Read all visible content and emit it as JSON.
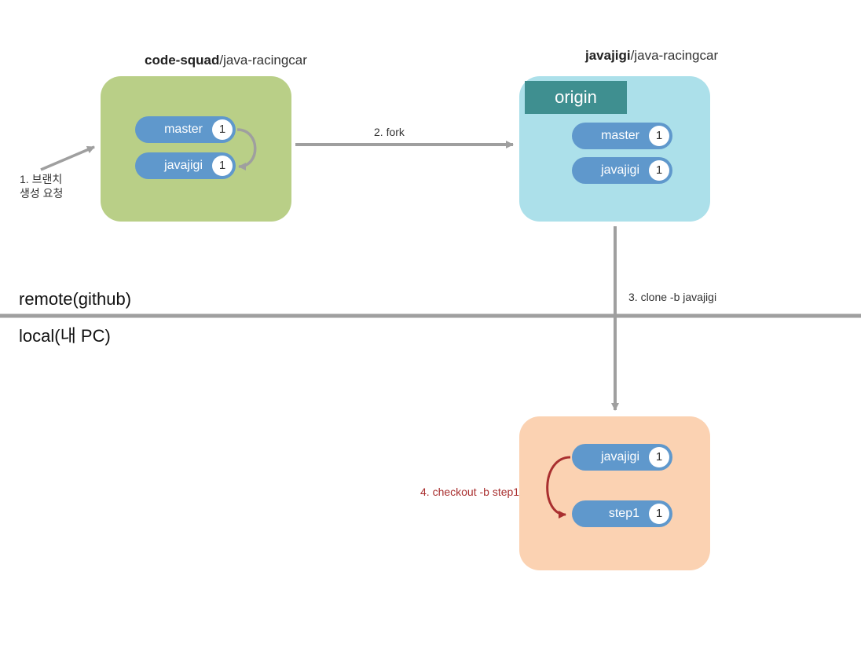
{
  "repo_left": {
    "title_bold": "code-squad",
    "title_rest": "/java-racingcar",
    "branches": [
      {
        "name": "master",
        "count": "1"
      },
      {
        "name": "javajigi",
        "count": "1"
      }
    ]
  },
  "repo_right": {
    "title_bold": "javajigi",
    "title_rest": "/java-racingcar",
    "origin_label": "origin",
    "branches": [
      {
        "name": "master",
        "count": "1"
      },
      {
        "name": "javajigi",
        "count": "1"
      }
    ]
  },
  "repo_local": {
    "branches": [
      {
        "name": "javajigi",
        "count": "1"
      },
      {
        "name": "step1",
        "count": "1"
      }
    ]
  },
  "actions": {
    "branch_request_line1": "1. 브랜치",
    "branch_request_line2": "생성 요청",
    "fork": "2. fork",
    "clone": "3. clone -b javajigi",
    "checkout": "4. checkout -b step1"
  },
  "sections": {
    "remote": "remote(github)",
    "local": "local(내 PC)"
  }
}
